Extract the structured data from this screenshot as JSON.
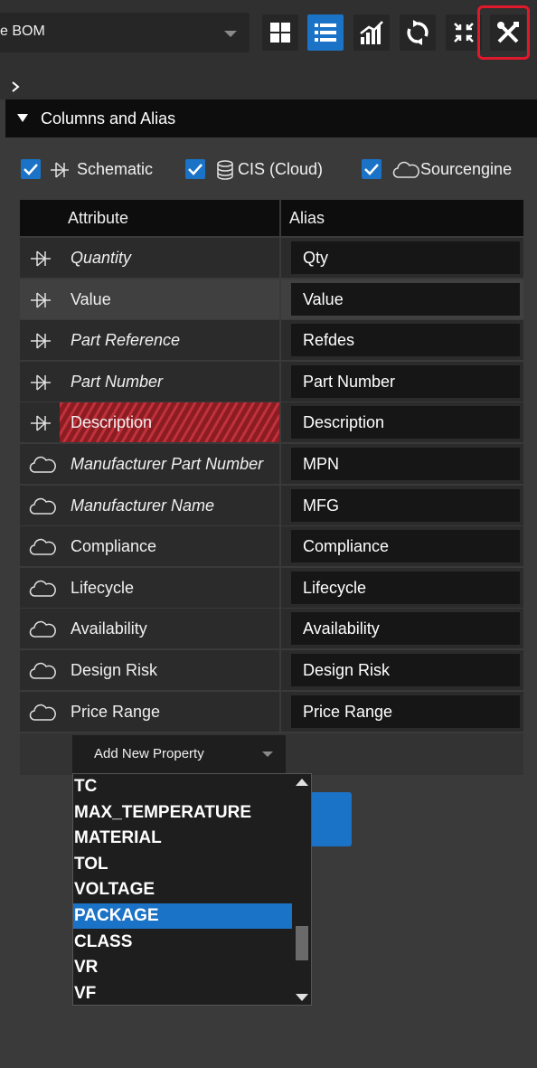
{
  "toolbar": {
    "bom_selector_value": "e BOM",
    "buttons": [
      {
        "icon": "grid-view-icon"
      },
      {
        "icon": "list-view-icon",
        "active": true
      },
      {
        "icon": "chart-icon"
      },
      {
        "icon": "refresh-icon"
      },
      {
        "icon": "collapse-icon"
      },
      {
        "icon": "tools-icon",
        "highlighted": true
      }
    ]
  },
  "section": {
    "title": "Columns and Alias"
  },
  "filters": [
    {
      "label": "Schematic",
      "checked": true,
      "icon": "schematic-icon"
    },
    {
      "label": "CIS (Cloud)",
      "checked": true,
      "icon": "database-icon"
    },
    {
      "label": "Sourcengine",
      "checked": true,
      "icon": "cloud-icon"
    }
  ],
  "table": {
    "headers": {
      "attribute": "Attribute",
      "alias": "Alias"
    },
    "rows": [
      {
        "attribute": "Quantity",
        "alias": "Qty",
        "icon": "schematic-icon",
        "italic": true
      },
      {
        "attribute": "Value",
        "alias": "Value",
        "icon": "schematic-icon",
        "italic": false
      },
      {
        "attribute": "Part Reference",
        "alias": "Refdes",
        "icon": "schematic-icon",
        "italic": true
      },
      {
        "attribute": "Part Number",
        "alias": "Part Number",
        "icon": "schematic-icon",
        "italic": true
      },
      {
        "attribute": "Description",
        "alias": "Description",
        "icon": "schematic-icon",
        "italic": false
      },
      {
        "attribute": "Manufacturer Part Number",
        "alias": "MPN",
        "icon": "cloud-icon",
        "italic": true
      },
      {
        "attribute": "Manufacturer Name",
        "alias": "MFG",
        "icon": "cloud-icon",
        "italic": true
      },
      {
        "attribute": "Compliance",
        "alias": "Compliance",
        "icon": "cloud-icon",
        "italic": false
      },
      {
        "attribute": "Lifecycle",
        "alias": "Lifecycle",
        "icon": "cloud-icon",
        "italic": false
      },
      {
        "attribute": "Availability",
        "alias": "Availability",
        "icon": "cloud-icon",
        "italic": false
      },
      {
        "attribute": "Design Risk",
        "alias": "Design Risk",
        "icon": "cloud-icon",
        "italic": false
      },
      {
        "attribute": "Price Range",
        "alias": "Price Range",
        "icon": "cloud-icon",
        "italic": false
      }
    ]
  },
  "add_property": {
    "label": "Add New Property"
  },
  "dropdown": {
    "options": [
      "TC",
      "MAX_TEMPERATURE",
      "MATERIAL",
      "TOL",
      "VOLTAGE",
      "PACKAGE",
      "CLASS",
      "VR",
      "VF"
    ],
    "selected": "PACKAGE"
  },
  "colors": {
    "accent": "#1a73c6",
    "highlight_border": "#e0182b",
    "error_hatch": "#c0313b",
    "background": "#3a3a3a"
  }
}
